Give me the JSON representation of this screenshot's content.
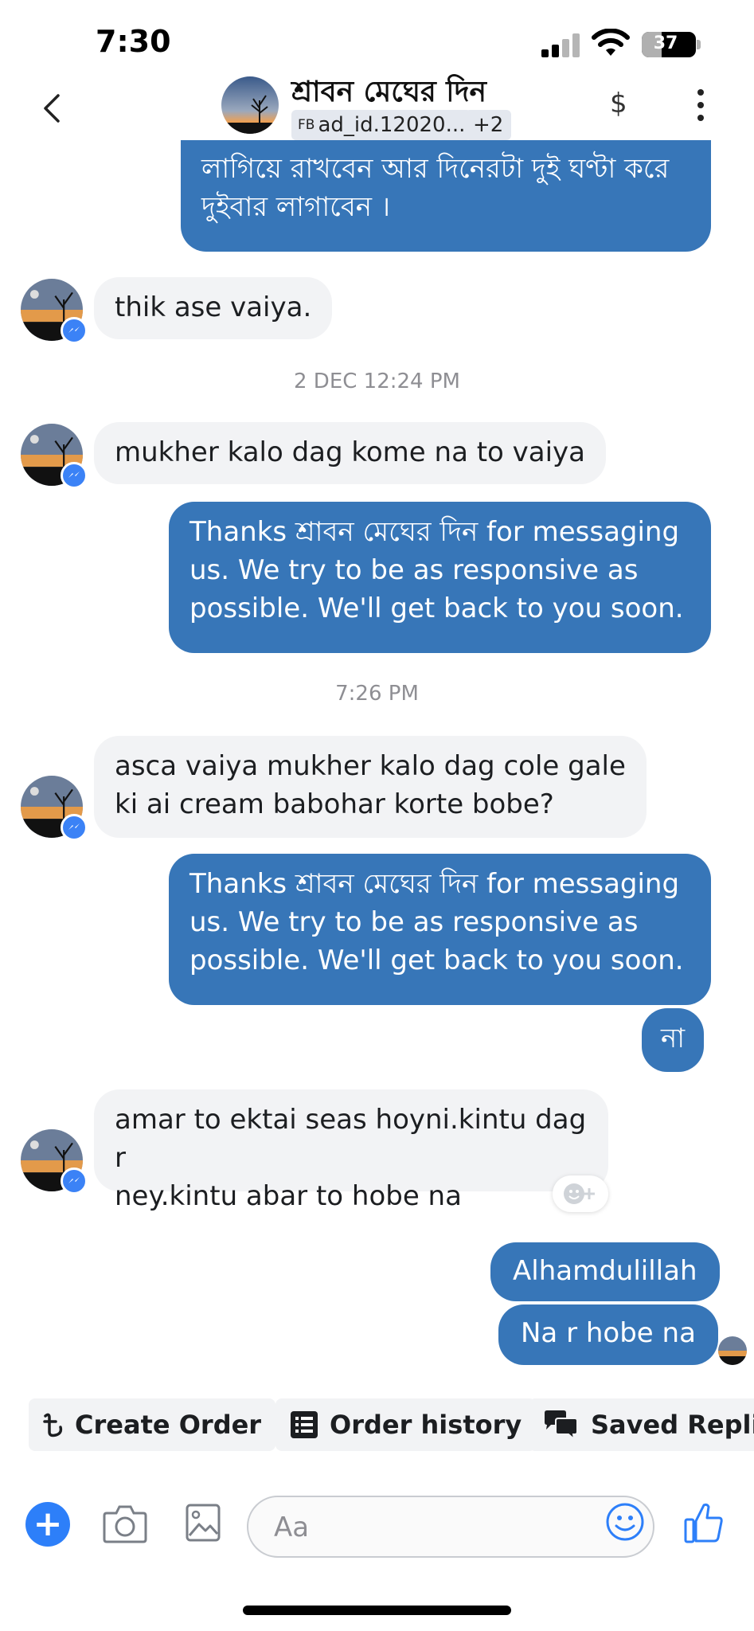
{
  "status_bar": {
    "time": "7:30",
    "battery": "37",
    "battery_level": 0.37
  },
  "header": {
    "contact_name": "শ্রাবন মেঘের দিন",
    "ad_tag_prefix": "FB",
    "ad_tag": "ad_id.12020...",
    "more_tags": "+2",
    "payment_symbol": "$",
    "back_icon": "chevron-left-icon",
    "menu_icon": "kebab-icon"
  },
  "messages": [
    {
      "side": "out",
      "text": "লাগিয়ে রাখবেন আর দিনেরটা দুই ঘণ্টা করে\nদুইবার লাগাবেন ।"
    },
    {
      "side": "in",
      "text": "thik ase vaiya."
    },
    {
      "side": "time",
      "text": "2 DEC 12:24 PM"
    },
    {
      "side": "in",
      "text": "mukher kalo dag kome na to vaiya"
    },
    {
      "side": "out",
      "text": "Thanks শ্রাবন মেঘের দিন  for messaging\nus. We try to be as responsive as\npossible. We'll get back to you soon."
    },
    {
      "side": "time",
      "text": "7:26 PM"
    },
    {
      "side": "in",
      "text": "asca vaiya mukher kalo dag  cole gale\nki ai cream babohar korte bobe?"
    },
    {
      "side": "out",
      "text": "Thanks শ্রাবন মেঘের দিন  for messaging\nus. We try to be as responsive as\npossible. We'll get back to you soon."
    },
    {
      "side": "out",
      "text": "না"
    },
    {
      "side": "in",
      "text": "amar to ektai seas hoyni.kintu dag r\nney.kintu abar to hobe na"
    },
    {
      "side": "out",
      "text": "Alhamdulillah"
    },
    {
      "side": "out",
      "text": "Na r hobe na"
    }
  ],
  "quick_actions": [
    {
      "label": "Create Order",
      "icon": "taka-icon"
    },
    {
      "label": "Order history",
      "icon": "list-icon"
    },
    {
      "label": "Saved Replies",
      "icon": "chat-bubbles-icon"
    }
  ],
  "composer": {
    "placeholder": "Aa",
    "plus_symbol": "+"
  },
  "colors": {
    "outgoing_bubble": "#3776b8",
    "incoming_bubble": "#f2f3f5",
    "accent": "#2d7ff9"
  }
}
